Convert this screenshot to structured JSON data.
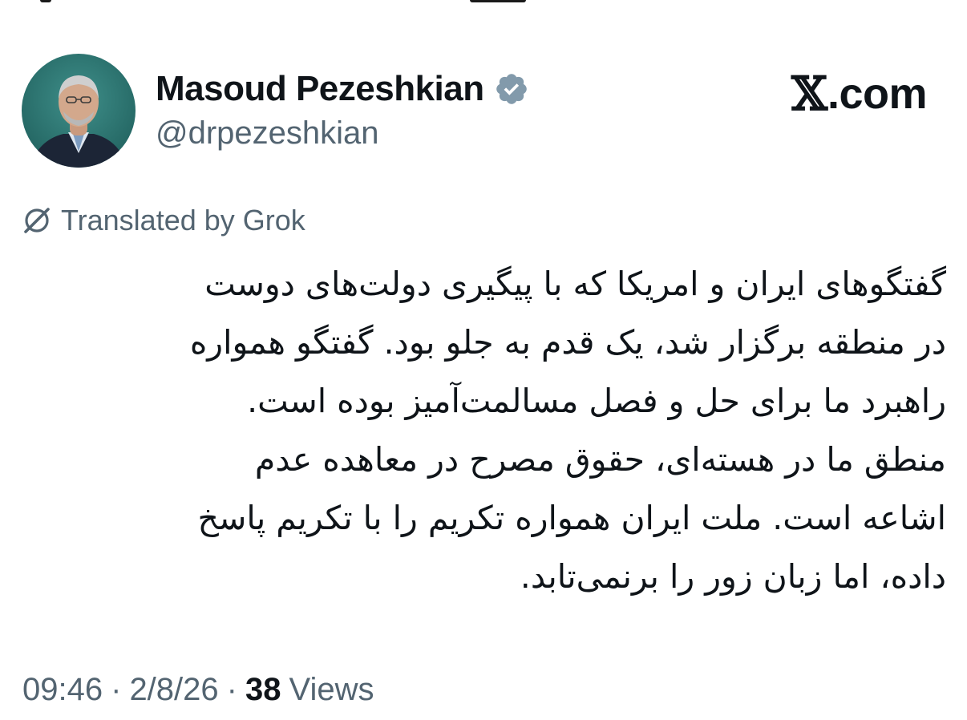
{
  "author": {
    "display_name": "Masoud Pezeshkian",
    "handle": "@drpezeshkian",
    "verified": true,
    "verified_color": "#829aab"
  },
  "brand": {
    "mark": "𝕏",
    "text": ".com"
  },
  "translation": {
    "icon": "grok-icon",
    "label": "Translated by Grok"
  },
  "tweet": {
    "lines": [
      "گفتگوهای ایران و امریکا که با پیگیری دولت‌های دوست",
      "در منطقه برگزار شد، یک قدم به جلو بود. گفتگو همواره",
      "راهبرد ما برای حل و فصل مسالمت‌آمیز بوده است.",
      "منطق ما در هسته‌ای، حقوق مصرح در معاهده عدم",
      "اشاعه است. ملت ایران همواره تکریم را با تکریم پاسخ",
      "داده، اما زبان زور را برنمی‌تابد."
    ]
  },
  "meta": {
    "time": "09:46",
    "date": "2/8/26",
    "separator": "·",
    "views_count": "38",
    "views_label": "Views"
  },
  "colors": {
    "text_primary": "#0f1419",
    "text_secondary": "#536471",
    "background": "#ffffff"
  }
}
